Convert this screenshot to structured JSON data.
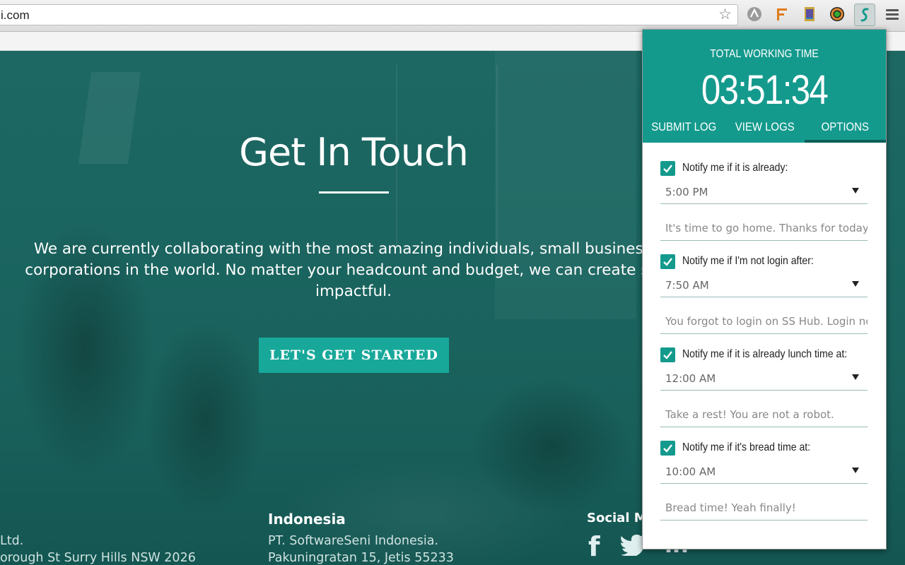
{
  "browser": {
    "url": "i.com",
    "extensions": [
      "bookmark-star-icon",
      "globe-extension-icon",
      "f-extension-icon",
      "book-extension-icon",
      "color-wheel-extension-icon",
      "s-hub-extension-icon",
      "menu-icon"
    ]
  },
  "hero": {
    "title": "Get In Touch",
    "body_line1": "We are currently collaborating with the most amazing individuals, small businesses,",
    "body_line2": "corporations in the world. No matter your headcount and budget, we can create some",
    "body_line3": "impactful.",
    "cta_label": "LET'S GET STARTED"
  },
  "footer": {
    "left_line1": "Ltd.",
    "left_line2": "orough St Surry Hills NSW 2026",
    "indonesia_title": "Indonesia",
    "indonesia_line1": "PT. SoftwareSeni Indonesia.",
    "indonesia_line2": "Pakuningratan 15, Jetis 55233",
    "social_title": "Social Me",
    "social_icons": [
      "facebook-icon",
      "twitter-icon",
      "linkedin-icon"
    ]
  },
  "popup": {
    "working_time_label": "TOTAL WORKING TIME",
    "working_time_value": "03:51:34",
    "tabs": [
      {
        "label": "SUBMIT LOG",
        "active": false
      },
      {
        "label": "VIEW LOGS",
        "active": false
      },
      {
        "label": "OPTIONS",
        "active": true
      }
    ],
    "options": [
      {
        "label": "Notify me if it is already:",
        "checked": true,
        "time": "5:00 PM",
        "message": "It's time to go home. Thanks for today!"
      },
      {
        "label": "Notify me if I'm not login after:",
        "checked": true,
        "time": "7:50 AM",
        "message": "You forgot to login on SS Hub. Login now!"
      },
      {
        "label": "Notify me if it is already lunch time at:",
        "checked": true,
        "time": "12:00 AM",
        "message": "Take a rest! You are not a robot."
      },
      {
        "label": "Notify me if it's bread time at:",
        "checked": true,
        "time": "10:00 AM",
        "message": "Bread time! Yeah finally!"
      }
    ]
  },
  "colors": {
    "accent": "#149a8d",
    "hero_bg": "#1d6863",
    "cta": "#17a89a"
  }
}
